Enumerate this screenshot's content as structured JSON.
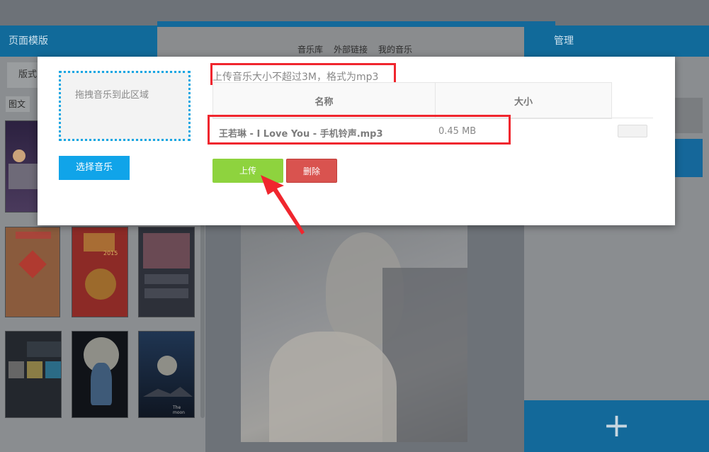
{
  "background": {
    "left_header": "页面模版",
    "left_tab": "版式",
    "left_filter": "图文",
    "right_header": "管理",
    "nav_tabs": [
      "音乐库",
      "外部链接",
      "我的音乐"
    ],
    "add_icon": "+",
    "thumbnails": [
      {
        "theme": "profile-purple"
      },
      {
        "theme": "chinese-new-year-red"
      },
      {
        "theme": "greeting-2015"
      },
      {
        "theme": "video-list-dark"
      },
      {
        "theme": "contact-tiles"
      },
      {
        "theme": "anime-moon"
      },
      {
        "theme": "moon-mountain",
        "caption": "The moon"
      }
    ],
    "greeting_year": "2015"
  },
  "modal": {
    "dropzone_text": "拖拽音乐到此区域",
    "choose_button": "选择音乐",
    "hint": "上传音乐大小不超过3M，格式为mp3",
    "table": {
      "headers": [
        "名称",
        "大小"
      ],
      "rows": [
        {
          "name": "王若琳 - I Love You - 手机铃声.mp3",
          "size": "0.45 MB"
        }
      ]
    },
    "upload_button": "上传",
    "delete_button": "删除"
  },
  "colors": {
    "accent_blue": "#10a4e9",
    "upload_green": "#8ed33e",
    "delete_red": "#d9534f",
    "annotation_red": "#f0262e"
  }
}
